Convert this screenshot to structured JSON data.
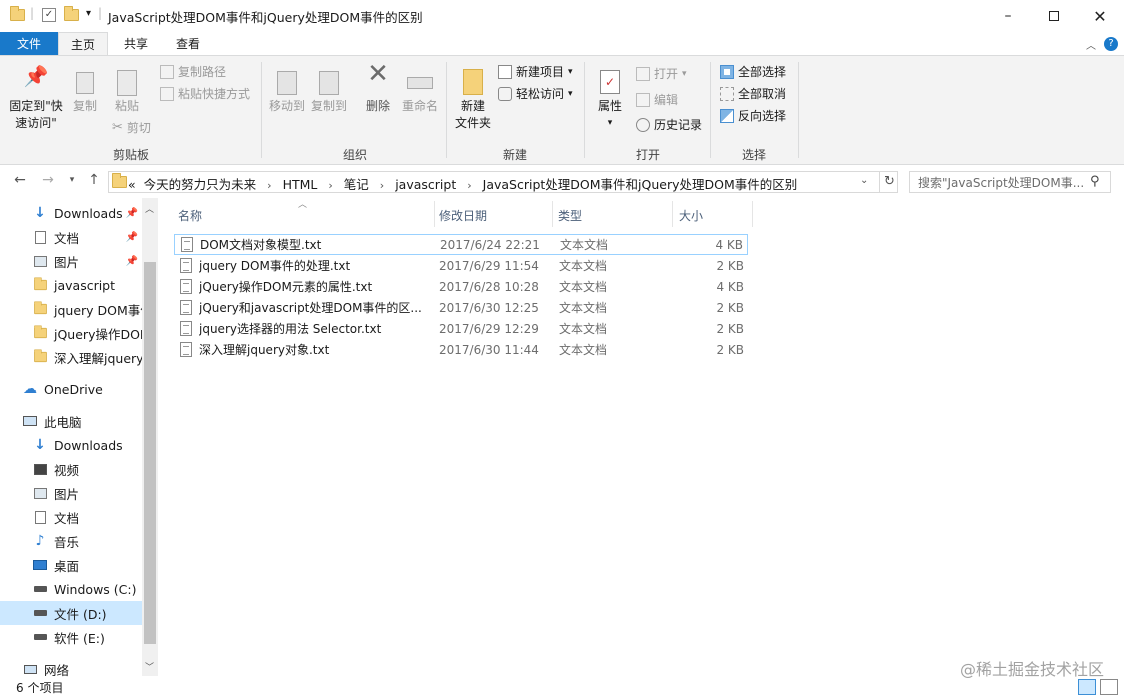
{
  "window": {
    "title": "JavaScript处理DOM事件和jQuery处理DOM事件的区别",
    "minimize_icon": "minimize-icon",
    "maximize_icon": "maximize-icon",
    "close_icon": "close-icon"
  },
  "tabs": {
    "file": "文件",
    "home": "主页",
    "share": "共享",
    "view": "查看"
  },
  "ribbon": {
    "clipboard": {
      "label": "剪贴板",
      "pin_line1": "固定到\"快",
      "pin_line2": "速访问\"",
      "copy": "复制",
      "paste": "粘贴",
      "copy_path": "复制路径",
      "paste_shortcut": "粘贴快捷方式",
      "cut": "剪切"
    },
    "organize": {
      "label": "组织",
      "move_to": "移动到",
      "copy_to": "复制到",
      "delete": "删除",
      "rename": "重命名"
    },
    "new": {
      "label": "新建",
      "new_folder_line1": "新建",
      "new_folder_line2": "文件夹",
      "new_item": "新建项目",
      "easy_access": "轻松访问"
    },
    "open": {
      "label": "打开",
      "properties": "属性",
      "open": "打开",
      "edit": "编辑",
      "history": "历史记录"
    },
    "select": {
      "label": "选择",
      "select_all": "全部选择",
      "select_none": "全部取消",
      "invert": "反向选择"
    }
  },
  "address": {
    "crumbs": [
      "今天的努力只为未来",
      "HTML",
      "笔记",
      "javascript",
      "JavaScript处理DOM事件和jQuery处理DOM事件的区别"
    ],
    "overflow": "«",
    "search_placeholder": "搜索\"JavaScript处理DOM事..."
  },
  "nav": {
    "quick": [
      {
        "label": "Downloads",
        "icon": "download-icon",
        "pinned": true
      },
      {
        "label": "文档",
        "icon": "document-icon",
        "pinned": true
      },
      {
        "label": "图片",
        "icon": "picture-icon",
        "pinned": true
      },
      {
        "label": "javascript",
        "icon": "folder-icon",
        "pinned": false
      },
      {
        "label": "jquery DOM事件",
        "icon": "folder-icon",
        "pinned": false
      },
      {
        "label": "jQuery操作DOM",
        "icon": "folder-icon",
        "pinned": false
      },
      {
        "label": "深入理解jquery对",
        "icon": "folder-icon",
        "pinned": false
      }
    ],
    "onedrive": "OneDrive",
    "thispc": "此电脑",
    "pc_items": [
      {
        "label": "Downloads",
        "icon": "download-icon"
      },
      {
        "label": "视频",
        "icon": "video-icon"
      },
      {
        "label": "图片",
        "icon": "picture-icon"
      },
      {
        "label": "文档",
        "icon": "document-icon"
      },
      {
        "label": "音乐",
        "icon": "music-icon"
      },
      {
        "label": "桌面",
        "icon": "desktop-icon"
      },
      {
        "label": "Windows (C:)",
        "icon": "drive-icon"
      },
      {
        "label": "文件 (D:)",
        "icon": "drive-icon",
        "selected": true
      },
      {
        "label": "软件 (E:)",
        "icon": "drive-icon"
      }
    ],
    "network": "网络"
  },
  "columns": {
    "name": "名称",
    "date": "修改日期",
    "type": "类型",
    "size": "大小"
  },
  "files": [
    {
      "name": "DOM文档对象模型.txt",
      "date": "2017/6/24 22:21",
      "type": "文本文档",
      "size": "4 KB",
      "selected": true
    },
    {
      "name": "jquery DOM事件的处理.txt",
      "date": "2017/6/29 11:54",
      "type": "文本文档",
      "size": "2 KB"
    },
    {
      "name": "jQuery操作DOM元素的属性.txt",
      "date": "2017/6/28 10:28",
      "type": "文本文档",
      "size": "4 KB"
    },
    {
      "name": "jQuery和javascript处理DOM事件的区...",
      "date": "2017/6/30 12:25",
      "type": "文本文档",
      "size": "2 KB"
    },
    {
      "name": "jquery选择器的用法 Selector.txt",
      "date": "2017/6/29 12:29",
      "type": "文本文档",
      "size": "2 KB"
    },
    {
      "name": "深入理解jquery对象.txt",
      "date": "2017/6/30 11:44",
      "type": "文本文档",
      "size": "2 KB"
    }
  ],
  "status": {
    "count": "6 个项目",
    "watermark": "@稀土掘金技术社区"
  },
  "colors": {
    "accent": "#1979ca",
    "selection": "#cce8ff",
    "ribbon_bg": "#f3f3f3"
  }
}
